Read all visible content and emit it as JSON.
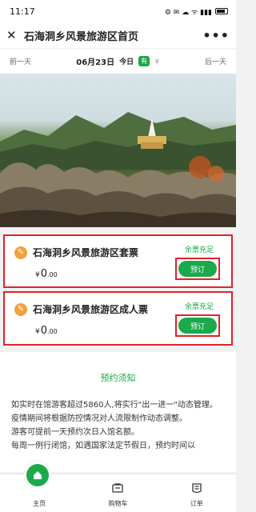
{
  "status_bar": {
    "time": "11:17",
    "icons": "⚙ ✉ ☁ ᯤ ▮▮▮"
  },
  "header": {
    "close_icon": "✕",
    "title": "石海洞乡风景旅游区首页",
    "more_icon": "•••"
  },
  "date_nav": {
    "prev": "前一天",
    "date": "06月23日",
    "today": "今日",
    "badge": "有",
    "next": "后一天"
  },
  "tickets": [
    {
      "name": "石海洞乡风景旅游区套票",
      "currency": "¥",
      "price_int": "0",
      "price_dec": ".00",
      "status": "余票充足",
      "button": "预订"
    },
    {
      "name": "石海洞乡风景旅游区成人票",
      "currency": "¥",
      "price_int": "0",
      "price_dec": ".00",
      "status": "余票充足",
      "button": "预订"
    }
  ],
  "notice": {
    "title": "预约须知",
    "paragraphs": [
      "如实时在馆游客超过5860人,将实行\"出一进一\"动态管理。疫情期间将根据防控情况对人流限制作动态调整。",
      "游客可提前一天预约次日入馆名额。",
      "每周一例行闭馆，如遇国家法定节假日，预约时间以"
    ]
  },
  "tabs": [
    {
      "label": "主页",
      "icon": "home-icon"
    },
    {
      "label": "购物车",
      "icon": "cart-icon"
    },
    {
      "label": "订单",
      "icon": "order-icon"
    }
  ],
  "colors": {
    "accent": "#1aa94b",
    "highlight": "#e0232b",
    "ticket_icon": "#f2a13b"
  }
}
